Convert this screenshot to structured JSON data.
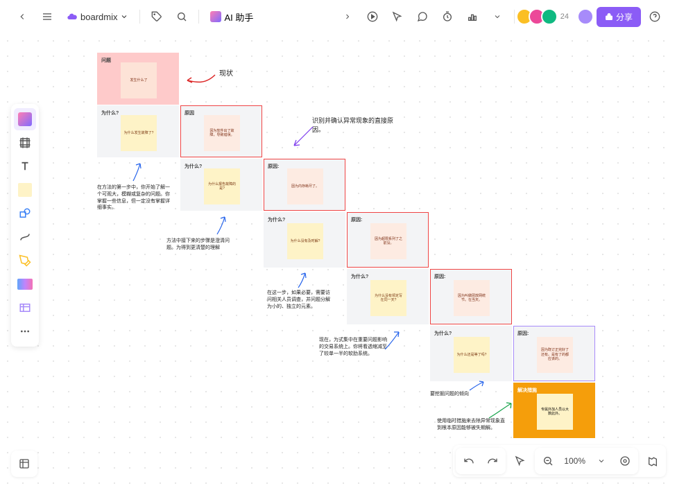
{
  "topbar": {
    "doc_name": "boardmix",
    "ai_label": "AI 助手",
    "share_label": "分享",
    "avatar_count": "24"
  },
  "tools": {
    "template": "模板",
    "frame": "框架",
    "text": "文本",
    "sticky": "便签",
    "shape": "形状",
    "line": "连线",
    "pen": "画笔",
    "gradient": "渐变",
    "more": "更多"
  },
  "canvas": {
    "title_anno": "现状",
    "cause_anno": "识别并确认异常现象的直接原因。",
    "step1_anno": "在方法的第一步中，你开始了解一个可观大，模糊或复杂的问题。你掌握一些信息，但一定没有掌握详细事实。",
    "step2_anno": "方法中接下来的步骤是澄清问题。为得到更清楚的理解",
    "step3_anno": "在这一步，如果必要，需要访问相关人员调查，并问题分解为小的、独立的元素。",
    "step4_anno": "现在，为式集中在重要问题影响的交易系统上。你将看透缩减至了较单一半的软肋系统。",
    "root_anno": "要挖掘问题的倾向",
    "solve_anno": "使用临时措施来去除异常现象直到根本原因能够被失期解。",
    "cells": {
      "c1": {
        "label": "问题",
        "note": "发生什么了"
      },
      "c2": {
        "label": "为什么?",
        "note": "为什么发生故障了?"
      },
      "c3": {
        "label": "原因",
        "note": "因为软件出了故障，导致错误。"
      },
      "c4": {
        "label": "为什么?",
        "note": "为什么报告故障的是?"
      },
      "c5": {
        "label": "原因:",
        "note": "因为内存耗尽了。"
      },
      "c6": {
        "label": "为什么?",
        "note": "为什么没有及时解?"
      },
      "c7": {
        "label": "原因:",
        "note": "因为超限系列了之前没。"
      },
      "c8": {
        "label": "为什么?",
        "note": "为什么没有领定写在同一天?"
      },
      "c9": {
        "label": "原因:",
        "note": "因为叫做团放网统节。在当天。"
      },
      "c10": {
        "label": "为什么?",
        "note": "为什么还是等了吗?"
      },
      "c11": {
        "label": "原因:",
        "note": "因为既订正完好了还有。是有了的都应该的。"
      },
      "c12": {
        "label": "解决措施",
        "note": "专属外加人员以大数此外。"
      }
    }
  },
  "bottom": {
    "zoom": "100%"
  }
}
